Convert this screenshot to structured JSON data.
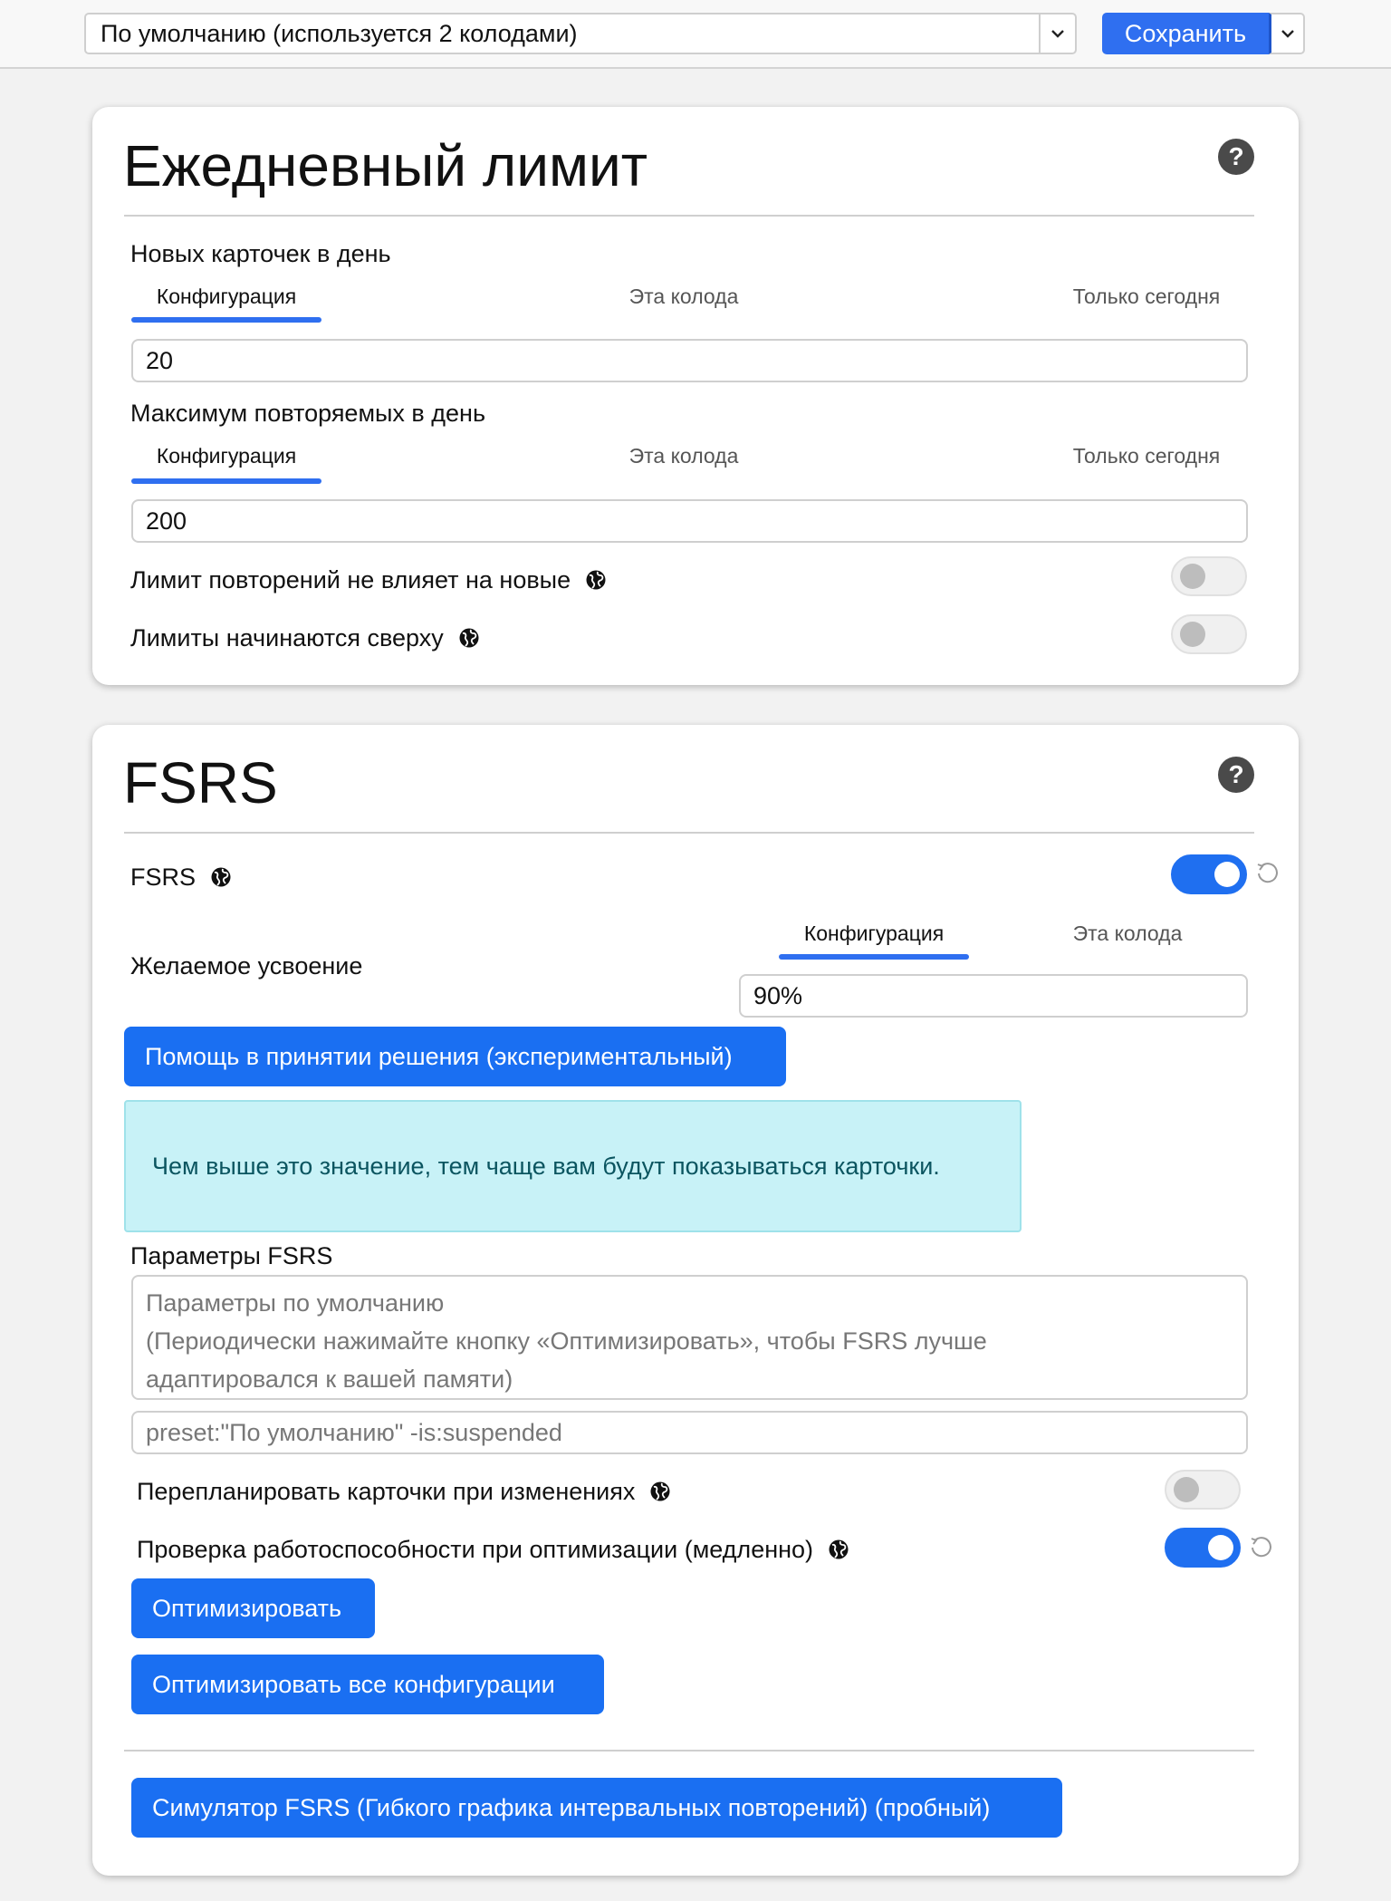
{
  "topbar": {
    "preset_value": "По умолчанию (используется 2 колодами)",
    "save_label": "Сохранить"
  },
  "daily_limits": {
    "title": "Ежедневный лимит",
    "new_cards": {
      "label": "Новых карточек в день",
      "tabs": [
        "Конфигурация",
        "Эта колода",
        "Только сегодня"
      ],
      "active_tab": 0,
      "value": "20"
    },
    "max_reviews": {
      "label": "Максимум повторяемых в день",
      "tabs": [
        "Конфигурация",
        "Эта колода",
        "Только сегодня"
      ],
      "active_tab": 0,
      "value": "200"
    },
    "review_limit_toggle": {
      "label": "Лимит повторений не влияет на новые",
      "on": false
    },
    "limits_top_toggle": {
      "label": "Лимиты начинаются сверху",
      "on": false
    }
  },
  "fsrs": {
    "title": "FSRS",
    "fsrs_toggle": {
      "label": "FSRS",
      "on": true
    },
    "desired_retention": {
      "label": "Желаемое усвоение",
      "tabs": [
        "Конфигурация",
        "Эта колода"
      ],
      "active_tab": 0,
      "value": "90%"
    },
    "help_decide_button": "Помощь в принятии решения (экспериментальный)",
    "info_text": "Чем выше это значение, тем чаще вам будут показываться карточки.",
    "params_label": "Параметры FSRS",
    "params_placeholder_lines": [
      "Параметры по умолчанию",
      "(Периодически нажимайте кнопку «Оптимизировать», чтобы FSRS лучше",
      "адаптировался к вашей памяти)"
    ],
    "search_query": "preset:\"По умолчанию\" -is:suspended",
    "reschedule_toggle": {
      "label": "Перепланировать карточки при изменениях",
      "on": false
    },
    "health_check_toggle": {
      "label": "Проверка работоспособности при оптимизации (медленно)",
      "on": true
    },
    "optimize_button": "Оптимизировать",
    "optimize_all_button": "Оптимизировать все конфигурации",
    "simulator_button": "Симулятор FSRS (Гибкого графика интервальных повторений) (пробный)"
  },
  "colors": {
    "accent": "#1a6ff2",
    "info_bg": "#c8f2f7",
    "info_text": "#0b5560"
  },
  "icons": [
    "chevron-down-icon",
    "help-icon",
    "globe-icon",
    "revert-icon"
  ]
}
